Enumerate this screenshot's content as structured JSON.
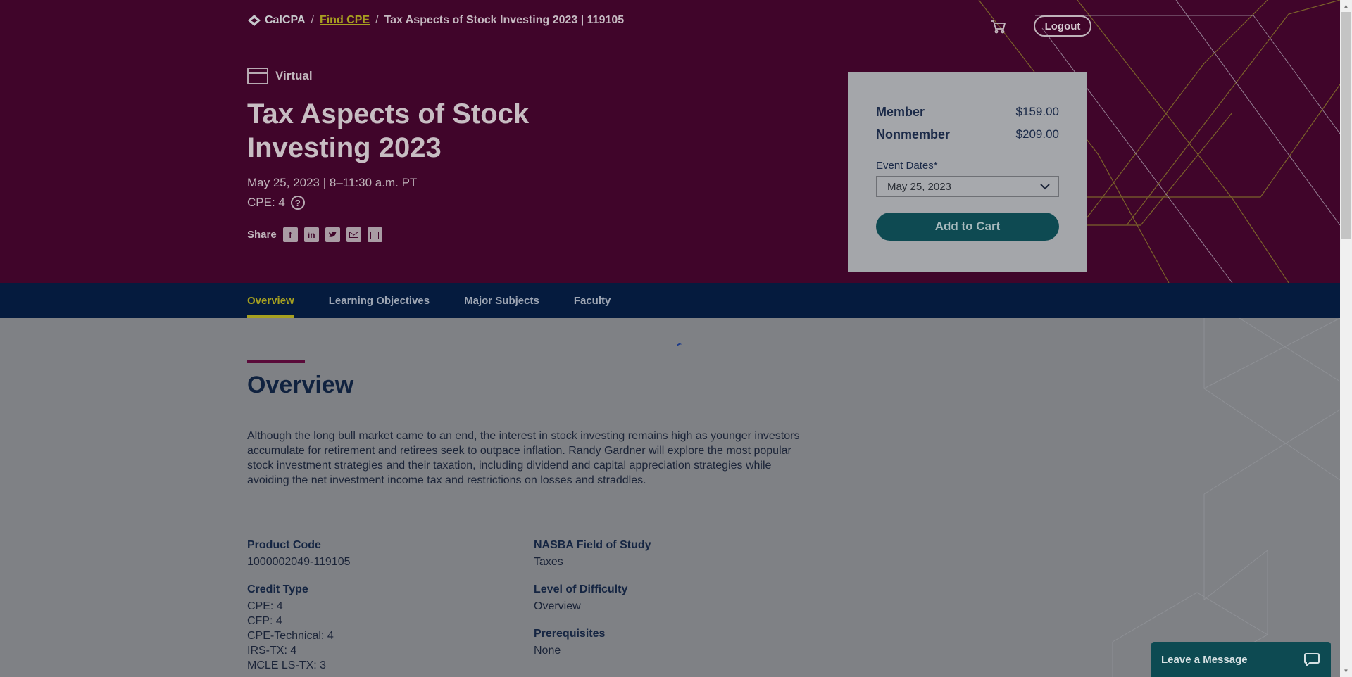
{
  "header": {
    "logo_text": "CalCPA",
    "breadcrumb": {
      "link": "Find CPE",
      "sep1": "/",
      "sep2": "/",
      "current": "Tax Aspects of Stock Investing 2023 | 119105"
    },
    "logout_label": "Logout"
  },
  "course": {
    "format": "Virtual",
    "title": "Tax Aspects of Stock Investing 2023",
    "date_line": "May 25, 2023 | 8–11:30 a.m. PT",
    "cpe_line": "CPE: 4",
    "help_glyph": "?",
    "share_label": "Share",
    "share_icons": [
      "facebook-icon",
      "linkedin-icon",
      "twitter-icon",
      "email-icon",
      "calendar-icon"
    ]
  },
  "pricing": {
    "member_label": "Member",
    "member_price": "$159.00",
    "nonmember_label": "Nonmember",
    "nonmember_price": "$209.00",
    "event_dates_label": "Event Dates*",
    "event_date_selected": "May 25, 2023",
    "add_to_cart": "Add to Cart"
  },
  "tabs": [
    {
      "label": "Overview",
      "active": true
    },
    {
      "label": "Learning Objectives",
      "active": false
    },
    {
      "label": "Major Subjects",
      "active": false
    },
    {
      "label": "Faculty",
      "active": false
    }
  ],
  "overview": {
    "heading": "Overview",
    "text": "Although the long bull market came to an end, the interest in stock investing remains high as younger investors accumulate for retirement and retirees seek to outpace inflation. Randy Gardner will explore the most popular stock investment strategies and their taxation, including dividend and capital appreciation strategies while avoiding the net investment income tax and restrictions on losses and straddles."
  },
  "details": {
    "product_code_label": "Product Code",
    "product_code": "1000002049-119105",
    "credit_type_label": "Credit Type",
    "credit_types": [
      "CPE: 4",
      "CFP: 4",
      "CPE-Technical: 4",
      "IRS-TX: 4",
      "MCLE LS-TX: 3"
    ],
    "field_label": "NASBA Field of Study",
    "field": "Taxes",
    "difficulty_label": "Level of Difficulty",
    "difficulty": "Overview",
    "prereq_label": "Prerequisites",
    "prereq": "None"
  },
  "chat": {
    "label": "Leave a Message"
  },
  "colors": {
    "hero_bg": "#40052a",
    "tabbar_bg": "#051b3e",
    "accent_gold": "#a6a020",
    "teal": "#0e4a52",
    "overlay_gray": "#7f8185"
  }
}
